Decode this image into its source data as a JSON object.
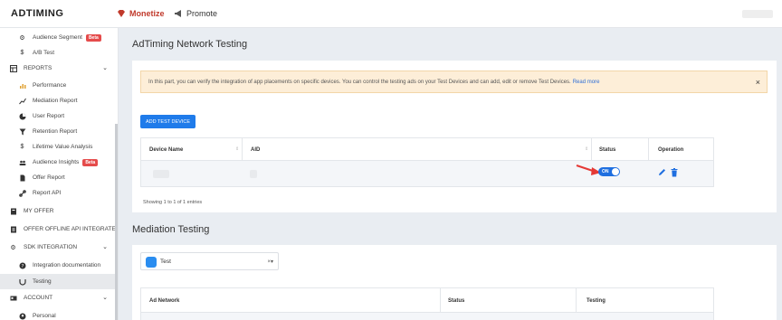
{
  "topbar": {
    "logo": "ADTIMING",
    "nav": [
      {
        "label": "Monetize",
        "icon": "diamond-icon",
        "active": true
      },
      {
        "label": "Promote",
        "icon": "megaphone-icon",
        "active": false
      }
    ]
  },
  "sidebar": {
    "items": [
      {
        "label": "Audience Segment",
        "icon": "cog-icon",
        "badge": "Beta"
      },
      {
        "label": "A/B Test",
        "icon": "dollar-icon"
      },
      {
        "label": "REPORTS",
        "icon": "table-icon"
      },
      {
        "label": "Performance",
        "icon": "bar-chart-icon"
      },
      {
        "label": "Mediation Report",
        "icon": "line-chart-icon"
      },
      {
        "label": "User Report",
        "icon": "pie-chart-icon"
      },
      {
        "label": "Retention Report",
        "icon": "filter-icon"
      },
      {
        "label": "Lifetime Value Analysis",
        "icon": "dollar-icon"
      },
      {
        "label": "Audience Insights",
        "icon": "users-icon",
        "badge": "Beta"
      },
      {
        "label": "Offer Report",
        "icon": "file-icon"
      },
      {
        "label": "Report API",
        "icon": "link-icon"
      },
      {
        "label": "MY OFFER",
        "icon": "book-icon"
      },
      {
        "label": "OFFER OFFLINE API INTEGRATE",
        "icon": "doc-icon"
      },
      {
        "label": "SDK INTEGRATION",
        "icon": "cogs-icon"
      },
      {
        "label": "Integration documentation",
        "icon": "question-icon"
      },
      {
        "label": "Testing",
        "icon": "code-icon"
      },
      {
        "label": "ACCOUNT",
        "icon": "id-card-icon"
      },
      {
        "label": "Personal",
        "icon": "user-circle-icon"
      }
    ]
  },
  "network_testing": {
    "title": "AdTiming Network Testing",
    "notice_text": "In this part, you can verify the integration of app placements on specific devices. You can control the testing ads on your Test Devices and can add, edit or remove Test Devices.",
    "notice_link": "Read more",
    "close": "×",
    "add_button": "ADD TEST DEVICE",
    "columns": [
      "Device Name",
      "AID",
      "Status",
      "Operation"
    ],
    "row": {
      "status": "ON"
    },
    "entries": "Showing 1 to 1 of 1 entries"
  },
  "mediation_testing": {
    "title": "Mediation Testing",
    "app_select": {
      "value": "Test",
      "platform": "",
      "chevron": "×▾"
    },
    "columns": [
      "Ad Network",
      "Status",
      "Testing"
    ]
  },
  "colors": {
    "accent": "#1f7bea",
    "monetize": "#c0392b",
    "beta": "#e54b4b",
    "notice_bg": "#fdeed8"
  }
}
